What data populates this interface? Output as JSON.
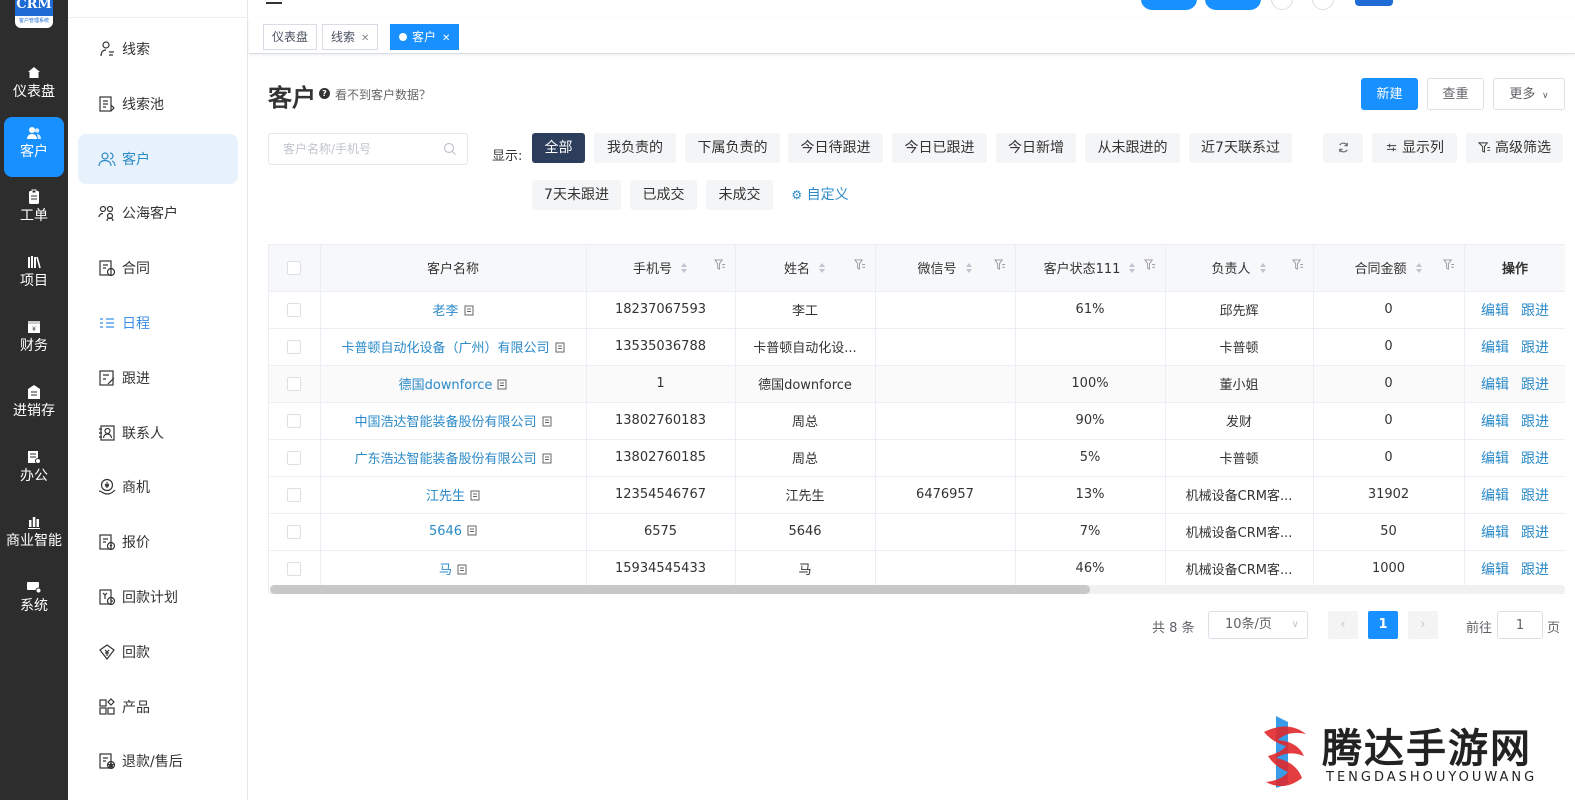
{
  "rail": {
    "logo_text": "CRM",
    "logo_sub": "客户管理系统",
    "items": [
      {
        "label": "仪表盘",
        "icon": "home-icon",
        "active": false
      },
      {
        "label": "客户",
        "icon": "users-icon",
        "active": true
      },
      {
        "label": "工单",
        "icon": "clipboard-icon",
        "active": false
      },
      {
        "label": "项目",
        "icon": "books-icon",
        "active": false
      },
      {
        "label": "财务",
        "icon": "finance-icon",
        "active": false
      },
      {
        "label": "进销存",
        "icon": "warehouse-icon",
        "active": false
      },
      {
        "label": "办公",
        "icon": "office-icon",
        "active": false
      },
      {
        "label": "商业智能",
        "icon": "bar-chart-icon",
        "active": false
      },
      {
        "label": "系统",
        "icon": "system-icon",
        "active": false
      }
    ]
  },
  "menu": {
    "items": [
      {
        "label": "线索",
        "icon": "lead-user-icon"
      },
      {
        "label": "线索池",
        "icon": "lead-pool-icon"
      },
      {
        "label": "客户",
        "icon": "customer-icon",
        "active": true
      },
      {
        "label": "公海客户",
        "icon": "public-customer-icon"
      },
      {
        "label": "合同",
        "icon": "contract-icon"
      },
      {
        "label": "日程",
        "icon": "schedule-icon",
        "highlight": true
      },
      {
        "label": "跟进",
        "icon": "follow-up-icon"
      },
      {
        "label": "联系人",
        "icon": "contact-icon"
      },
      {
        "label": "商机",
        "icon": "opportunity-icon"
      },
      {
        "label": "报价",
        "icon": "quote-icon"
      },
      {
        "label": "回款计划",
        "icon": "payment-plan-icon"
      },
      {
        "label": "回款",
        "icon": "payment-icon"
      },
      {
        "label": "产品",
        "icon": "product-icon"
      },
      {
        "label": "退款/售后",
        "icon": "refund-icon"
      }
    ]
  },
  "tabs": [
    {
      "label": "仪表盘",
      "closable": false,
      "active": false
    },
    {
      "label": "线索",
      "closable": true,
      "active": false
    },
    {
      "label": "客户",
      "closable": true,
      "active": true
    }
  ],
  "page": {
    "title": "客户",
    "help_text": "看不到客户数据？",
    "actions": {
      "new": "新建",
      "dedupe": "查重",
      "more": "更多"
    }
  },
  "filters": {
    "search_placeholder": "客户名称/手机号",
    "show_label": "显示:",
    "chips": [
      "全部",
      "我负责的",
      "下属负责的",
      "今日待跟进",
      "今日已跟进",
      "今日新增",
      "从未跟进的",
      "近7天联系过",
      "7天未跟进",
      "已成交",
      "未成交"
    ],
    "active_chip": "全部",
    "custom_label": "自定义",
    "tools": {
      "columns": "显示列",
      "advanced": "高级筛选"
    }
  },
  "table": {
    "columns": [
      "客户名称",
      "手机号",
      "姓名",
      "微信号",
      "客户状态111",
      "负责人",
      "合同金额",
      "操作"
    ],
    "rows": [
      {
        "name": "老李",
        "phone": "18237067593",
        "person": "李工",
        "wechat": "",
        "status": "61%",
        "owner": "邱先辉",
        "amount": "0"
      },
      {
        "name": "卡普顿自动化设备（广州）有限公司",
        "phone": "13535036788",
        "person": "卡普顿自动化设...",
        "wechat": "",
        "status": "",
        "owner": "卡普顿",
        "amount": "0"
      },
      {
        "name": "德国downforce",
        "phone": "1",
        "person": "德国downforce",
        "wechat": "",
        "status": "100%",
        "owner": "董小姐",
        "amount": "0"
      },
      {
        "name": "中国浩达智能装备股份有限公司",
        "phone": "13802760183",
        "person": "周总",
        "wechat": "",
        "status": "90%",
        "owner": "发财",
        "amount": "0"
      },
      {
        "name": "广东浩达智能装备股份有限公司",
        "phone": "13802760185",
        "person": "周总",
        "wechat": "",
        "status": "5%",
        "owner": "卡普顿",
        "amount": "0"
      },
      {
        "name": "江先生",
        "phone": "12354546767",
        "person": "江先生",
        "wechat": "6476957",
        "status": "13%",
        "owner": "机械设备CRM客...",
        "amount": "31902"
      },
      {
        "name": "5646",
        "phone": "6575",
        "person": "5646",
        "wechat": "",
        "status": "7%",
        "owner": "机械设备CRM客...",
        "amount": "50"
      },
      {
        "name": "马",
        "phone": "15934545433",
        "person": "马",
        "wechat": "",
        "status": "46%",
        "owner": "机械设备CRM客...",
        "amount": "1000"
      }
    ],
    "row_actions": {
      "edit": "编辑",
      "follow": "跟进"
    }
  },
  "pagination": {
    "total_text": "共 8 条",
    "page_size": "10条/页",
    "current_page": "1",
    "goto_label": "前往",
    "goto_value": "1",
    "page_suffix": "页"
  },
  "watermark": {
    "title": "腾达手游网",
    "subtitle": "TENGDASHOUYOUWANG"
  },
  "colors": {
    "primary": "#1890ff",
    "rail_bg": "#2d2d2d",
    "link": "#2b8ac8",
    "active_chip": "#2c3e5c"
  }
}
